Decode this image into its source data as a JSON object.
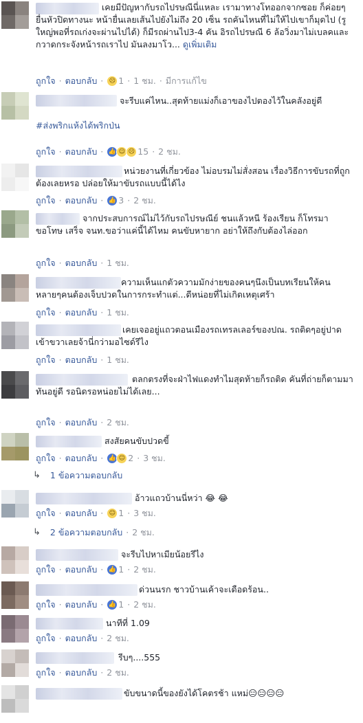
{
  "actions": {
    "like": "ถูกใจ",
    "reply": "ตอบกลับ",
    "sep": "·"
  },
  "comments": [
    {
      "text": "เคยมีปัญหากับรถไปรษณีนี่แหละ เรามาทางโทออกจากซอย ก็ค่อยๆยื่นหัวปิดทางนะ หน้ายื่นเลยเส้นไปยังไม่ถึง 20 เซ็น รถคันไหนที่ไม่ให้ไปเขาก็มุดไป (รูใหญ่พอที่รถเก่งจะผ่านไปได้) ก็มีรถผ่านไป3-4 คัน อิรถไปรษณี 6 ล้อวิ่งมาไม่เบลคและกวาดกระจังหน้ารถเราไป มันลงมาโว...",
      "see_more": "ดูเพิ่มเติม",
      "reaction_count": "1",
      "time": "1 ชม.",
      "edited": "มีการแก้ไข"
    },
    {
      "text": "จะรีบแค่ไหน..สุดท้ายแม่งก็เอาของไปตองไว้ในคลังอยู่ดี",
      "hashtag": "#ส่งพริกแห้งได้พริกป่น",
      "reaction_count": "15",
      "time": "2 ชม."
    },
    {
      "text": "หน่วยงานที่เกี่ยวข้อง ไม่อบรมไม่สั่งสอน เรื่องวิธีการขับรถที่ถูกต้องเลยหรอ ปล่อยให้มาขับรถแบบนี้ได้ไง",
      "reaction_count": "3",
      "time": "2 ชม."
    },
    {
      "text": "จากประสบการณ์ไม่ไว้กับรถไปรษณีย์ ชนแล้วหนี ร้องเรียน ก็โทรมาขอโทษ เสร็จ จนท.ขอว่าแค่นี้ได้ไหม คนขับหายาก อย่าให้ถึงกับต้องไล่ออก",
      "time": "1 ชม."
    },
    {
      "text": "ความเห็นแกตัวความมักง่ายของคนๆนึงเป็นบทเรียนให้คนหลายๆคนต้องเจ็บปวดในการกระทำแต่...ดีหน่อยที่ไม่เกิดเหตุเศร้า",
      "time": "1 ชม."
    },
    {
      "text": "เคยเจออยู่แถวตอนเมืองรถเทรลเลอร์ของปณ. รถติดๆอยู่ปาดเข้าขวาเลยจ้านี่กว่ามอไซด์รึไง",
      "time": "1 ชม."
    },
    {
      "text": "ตลกตรงที่จะฝ่าไฟแดงทำไมสุดท้ายก็รถติด คันที่ถ่ายก็ตามมาทันอยู่ดี รอนิดรอหน่อยไม่ได้เลย...",
      "time": "2 ชม."
    },
    {
      "text": "สงสัยคนขับปวดขี้",
      "reaction_count": "2",
      "time": "3 ชม.",
      "replies": "1 ข้อความตอบกลับ"
    },
    {
      "text": "อ้าวแถวบ้านนี่หว่า",
      "text_emoji": "😂 😂",
      "reaction_count": "1",
      "time": "3 ชม.",
      "replies": "2 ข้อความตอบกลับ",
      "replies_time": "2 ชม."
    },
    {
      "text": "จะรีบไปหาเมียน้อยรึไง",
      "reaction_count": "1",
      "time": "2 ชม."
    },
    {
      "text": "ด่วนนรก ชาวบ้านเค้าจะเดือดร้อน..",
      "reaction_count": "1",
      "time": "2 ชม."
    },
    {
      "text": "นาทีที่ 1.09",
      "time": "2 ชม."
    },
    {
      "text": "รีบๆ....555",
      "time": "2 ชม."
    },
    {
      "text": "ขับขนาดนี้ของยังได้โคตรช้า แหม่",
      "text_emoji": "😑😑😑😑"
    }
  ]
}
